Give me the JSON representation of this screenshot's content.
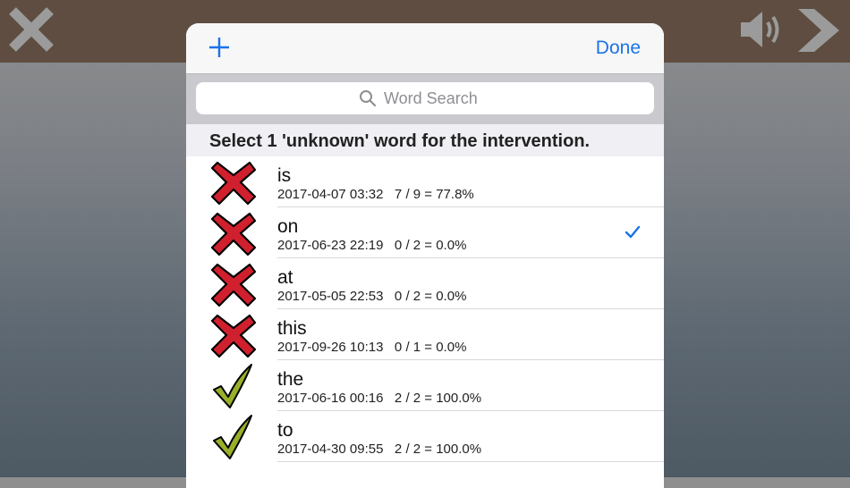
{
  "topbar": {
    "close_icon": "close-x-icon",
    "speaker_icon": "speaker-icon",
    "next_icon": "chevron-right-icon"
  },
  "modal": {
    "done_label": "Done",
    "add_icon": "plus-icon",
    "search": {
      "placeholder": "Word Search",
      "value": ""
    },
    "section_title": "Select 1 'unknown' word for the intervention.",
    "rows": [
      {
        "word": "is",
        "date": "2017-04-07 03:32",
        "score": "7 / 9 = 77.8%",
        "status_icon": "red-x-icon",
        "selected": false
      },
      {
        "word": "on",
        "date": "2017-06-23 22:19",
        "score": "0 / 2 = 0.0%",
        "status_icon": "red-x-icon",
        "selected": true
      },
      {
        "word": "at",
        "date": "2017-05-05 22:53",
        "score": "0 / 2 = 0.0%",
        "status_icon": "red-x-icon",
        "selected": false
      },
      {
        "word": "this",
        "date": "2017-09-26 10:13",
        "score": "0 / 1 = 0.0%",
        "status_icon": "red-x-icon",
        "selected": false
      },
      {
        "word": "the",
        "date": "2017-06-16 00:16",
        "score": "2 / 2 = 100.0%",
        "status_icon": "green-check-icon",
        "selected": false
      },
      {
        "word": "to",
        "date": "2017-04-30 09:55",
        "score": "2 / 2 = 100.0%",
        "status_icon": "green-check-icon",
        "selected": false
      }
    ]
  },
  "colors": {
    "topbar": "#5e4d40",
    "accent": "#1a73e8",
    "x_red": "#d0202e",
    "check_green": "#9aae2a"
  }
}
